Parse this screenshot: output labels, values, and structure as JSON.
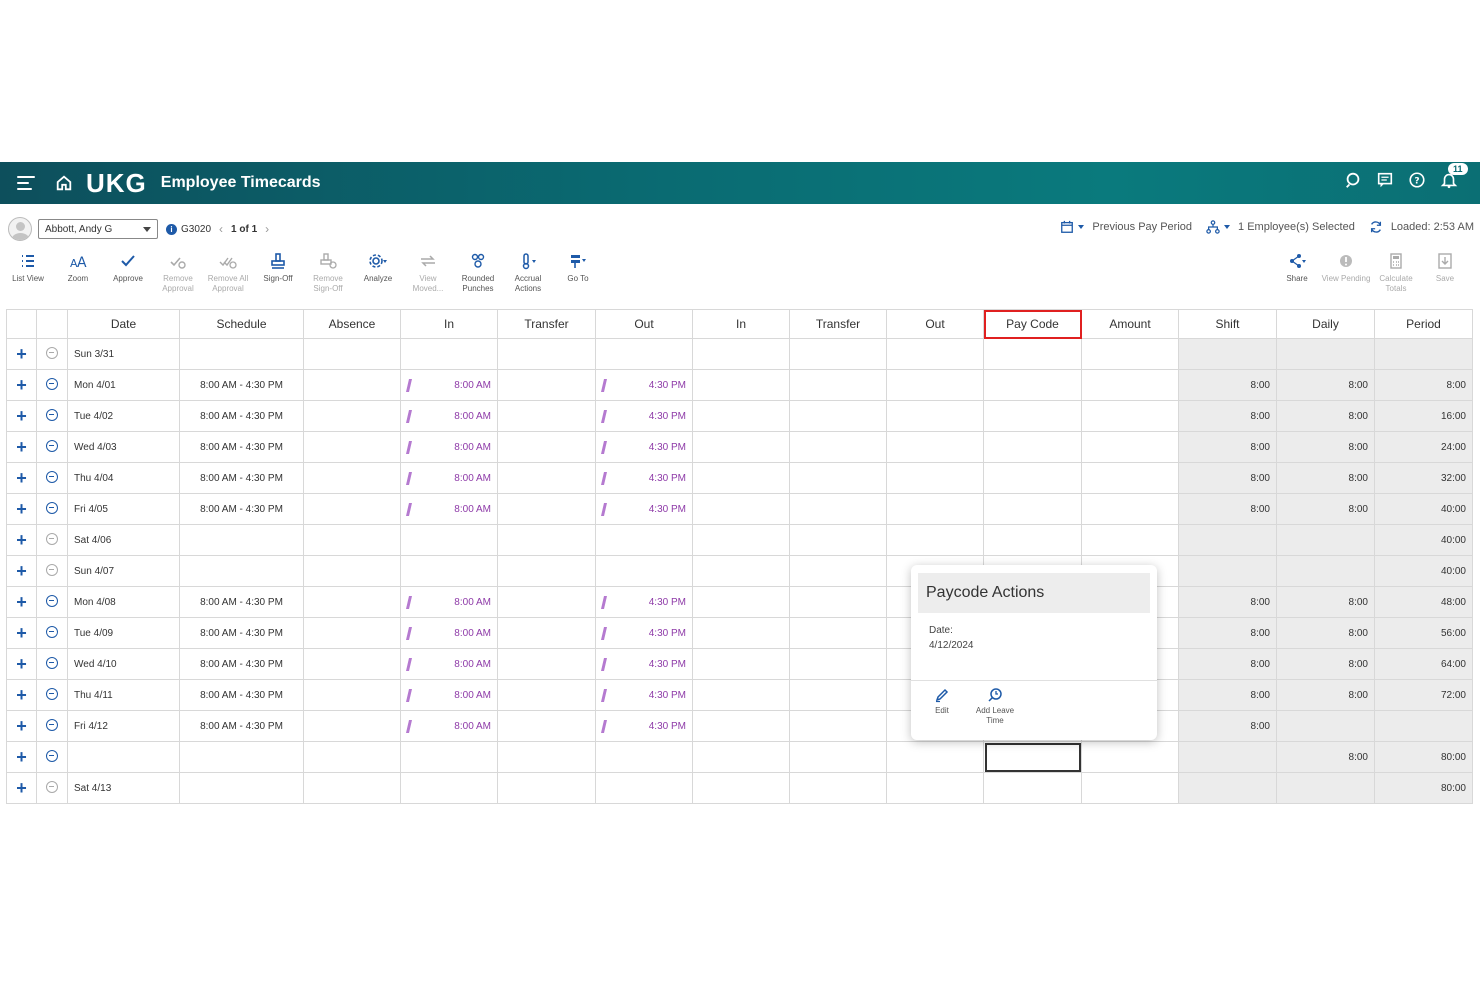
{
  "header": {
    "logo": "UKG",
    "title": "Employee Timecards",
    "notification_count": "11"
  },
  "employee_bar": {
    "employee_name": "Abbott, Andy G",
    "employee_id": "G3020",
    "pager": "1 of 1",
    "pay_period": "Previous Pay Period",
    "employees_selected": "1 Employee(s) Selected",
    "loaded": "Loaded: 2:53 AM"
  },
  "toolbar": {
    "list_view": "List View",
    "zoom": "Zoom",
    "approve": "Approve",
    "remove_approval": "Remove Approval",
    "remove_all_approval": "Remove All Approval",
    "sign_off": "Sign-Off",
    "remove_sign_off": "Remove Sign-Off",
    "analyze": "Analyze",
    "view_moved": "View Moved...",
    "rounded_punches": "Rounded Punches",
    "accrual_actions": "Accrual Actions",
    "go_to": "Go To",
    "share": "Share",
    "view_pending": "View Pending",
    "calculate_totals": "Calculate Totals",
    "save": "Save"
  },
  "grid": {
    "columns": [
      "Date",
      "Schedule",
      "Absence",
      "In",
      "Transfer",
      "Out",
      "In",
      "Transfer",
      "Out",
      "Pay Code",
      "Amount",
      "Shift",
      "Daily",
      "Period"
    ],
    "rows": [
      {
        "date": "Sun 3/31",
        "schedule": "",
        "in": "",
        "out": "",
        "shift": "",
        "daily": "",
        "period": "",
        "active": false
      },
      {
        "date": "Mon 4/01",
        "schedule": "8:00 AM - 4:30 PM",
        "in": "8:00 AM",
        "out": "4:30 PM",
        "shift": "8:00",
        "daily": "8:00",
        "period": "8:00",
        "active": true
      },
      {
        "date": "Tue 4/02",
        "schedule": "8:00 AM - 4:30 PM",
        "in": "8:00 AM",
        "out": "4:30 PM",
        "shift": "8:00",
        "daily": "8:00",
        "period": "16:00",
        "active": true
      },
      {
        "date": "Wed 4/03",
        "schedule": "8:00 AM - 4:30 PM",
        "in": "8:00 AM",
        "out": "4:30 PM",
        "shift": "8:00",
        "daily": "8:00",
        "period": "24:00",
        "active": true
      },
      {
        "date": "Thu 4/04",
        "schedule": "8:00 AM - 4:30 PM",
        "in": "8:00 AM",
        "out": "4:30 PM",
        "shift": "8:00",
        "daily": "8:00",
        "period": "32:00",
        "active": true
      },
      {
        "date": "Fri 4/05",
        "schedule": "8:00 AM - 4:30 PM",
        "in": "8:00 AM",
        "out": "4:30 PM",
        "shift": "8:00",
        "daily": "8:00",
        "period": "40:00",
        "active": true
      },
      {
        "date": "Sat 4/06",
        "schedule": "",
        "in": "",
        "out": "",
        "shift": "",
        "daily": "",
        "period": "40:00",
        "active": false
      },
      {
        "date": "Sun 4/07",
        "schedule": "",
        "in": "",
        "out": "",
        "shift": "",
        "daily": "",
        "period": "40:00",
        "active": false
      },
      {
        "date": "Mon 4/08",
        "schedule": "8:00 AM - 4:30 PM",
        "in": "8:00 AM",
        "out": "4:30 PM",
        "shift": "8:00",
        "daily": "8:00",
        "period": "48:00",
        "active": true
      },
      {
        "date": "Tue 4/09",
        "schedule": "8:00 AM - 4:30 PM",
        "in": "8:00 AM",
        "out": "4:30 PM",
        "shift": "8:00",
        "daily": "8:00",
        "period": "56:00",
        "active": true
      },
      {
        "date": "Wed 4/10",
        "schedule": "8:00 AM - 4:30 PM",
        "in": "8:00 AM",
        "out": "4:30 PM",
        "shift": "8:00",
        "daily": "8:00",
        "period": "64:00",
        "active": true
      },
      {
        "date": "Thu 4/11",
        "schedule": "8:00 AM - 4:30 PM",
        "in": "8:00 AM",
        "out": "4:30 PM",
        "shift": "8:00",
        "daily": "8:00",
        "period": "72:00",
        "active": true
      },
      {
        "date": "Fri 4/12",
        "schedule": "8:00 AM - 4:30 PM",
        "in": "8:00 AM",
        "out": "4:30 PM",
        "shift": "8:00",
        "daily": "",
        "period": "",
        "active": true
      },
      {
        "date": "",
        "schedule": "",
        "in": "",
        "out": "",
        "shift": "",
        "daily": "8:00",
        "period": "80:00",
        "active": true
      },
      {
        "date": "Sat 4/13",
        "schedule": "",
        "in": "",
        "out": "",
        "shift": "",
        "daily": "",
        "period": "80:00",
        "active": false
      }
    ]
  },
  "popup": {
    "title": "Paycode Actions",
    "date_label": "Date:",
    "date_value": "4/12/2024",
    "edit": "Edit",
    "add_leave_time": "Add Leave Time"
  },
  "colors": {
    "header_bg": "#0a6b72",
    "accent_blue": "#1e5aa8",
    "punch_purple": "#8e3aa8",
    "highlight_red": "#e02020"
  }
}
